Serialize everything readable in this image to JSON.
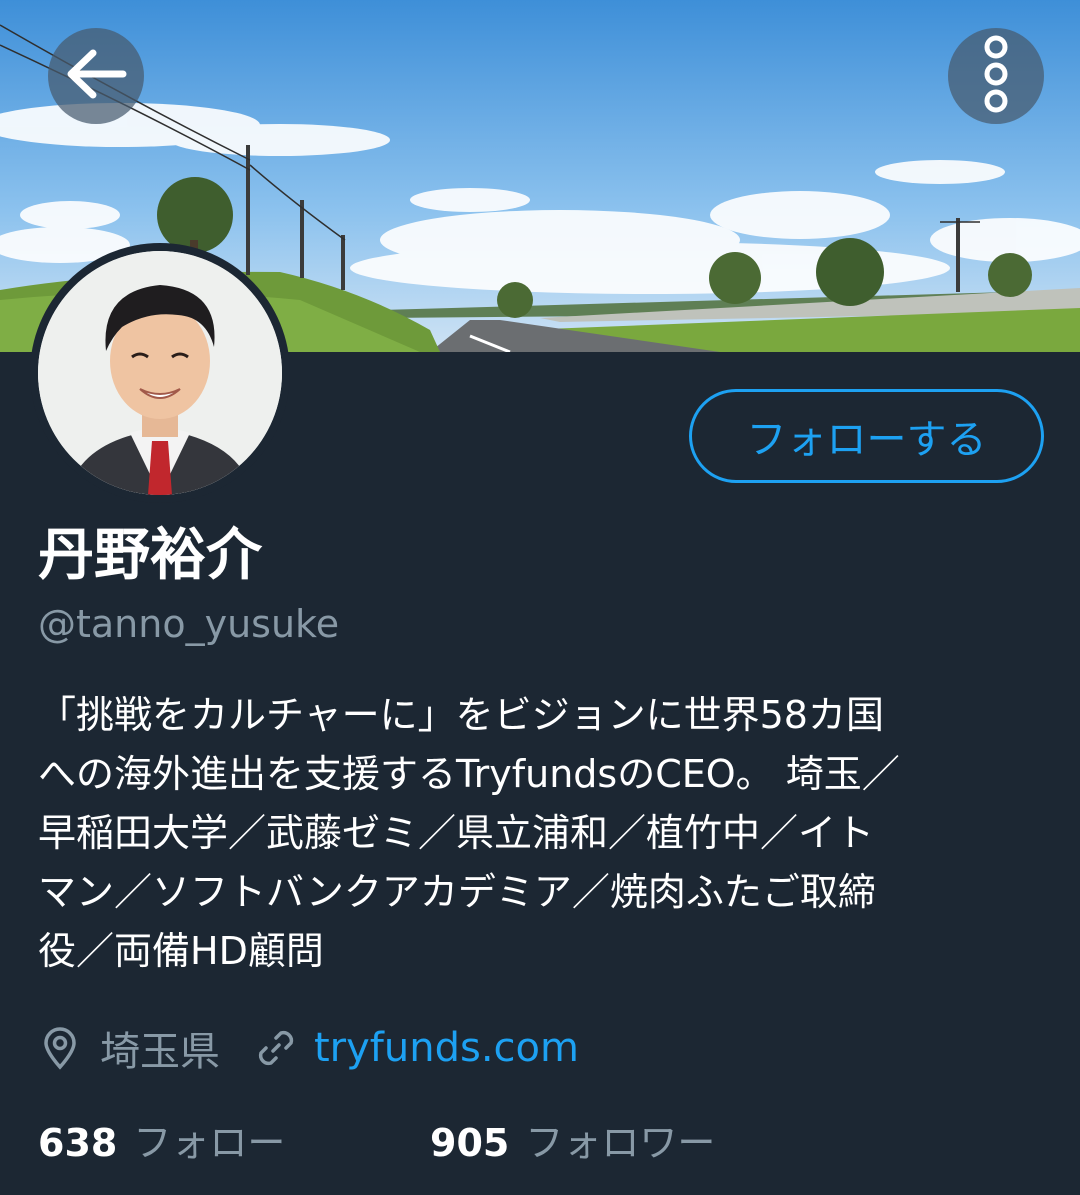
{
  "header": {
    "back_icon": "arrow-left-icon",
    "more_icon": "vertical-dots-icon"
  },
  "profile": {
    "display_name": "丹野裕介",
    "screen_name": "@tanno_yusuke",
    "follow_button_label": "フォローする",
    "bio": "「挑戦をカルチャーに」をビジョンに世界58カ国\nへの海外進出を支援するTryfundsのCEO。 埼玉／\n早稲田大学／武藤ゼミ／県立浦和／植竹中／イト\nマン／ソフトバンクアカデミア／焼肉ふたご取締\n役／両備HD顧問",
    "location": "埼玉県",
    "location_icon": "location-pin-icon",
    "website": "tryfunds.com",
    "website_icon": "link-icon"
  },
  "stats": {
    "following_count": "638",
    "following_label": "フォロー",
    "followers_count": "905",
    "followers_label": "フォロワー"
  },
  "colors": {
    "background": "#1c2733",
    "accent": "#1da1f2",
    "secondary_text": "#8899a6"
  }
}
